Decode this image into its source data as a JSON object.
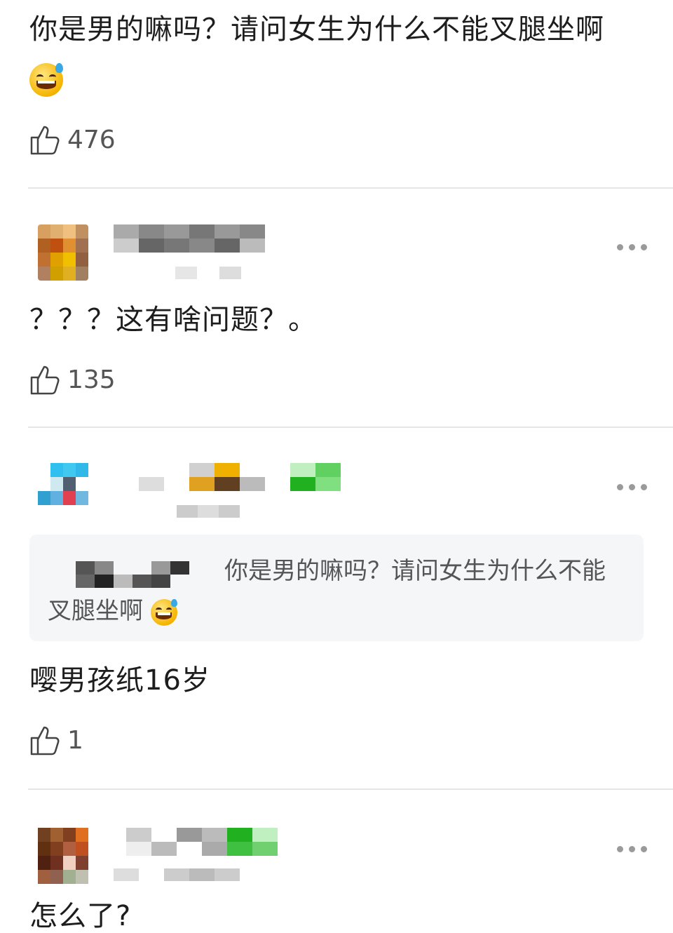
{
  "post": {
    "text": "你是男的嘛吗？请问女生为什么不能叉腿坐啊",
    "emoji": "sweat-smile-emoji",
    "likes": "476"
  },
  "comments": [
    {
      "text": "？？？这有啥问题？。",
      "likes": "135"
    },
    {
      "quote_text_line1": "你是男的嘛吗？请问女生为什么不能",
      "quote_text_line2": "叉腿坐啊",
      "text": "嘤男孩纸16岁",
      "likes": "1"
    },
    {
      "text": "怎么了?"
    }
  ],
  "colors": {
    "divider": "#e6e6e6",
    "text": "#1d1d1d",
    "muted": "#555555",
    "quote_bg": "#f5f6f8"
  },
  "icons": {
    "like": "thumbs-up-icon",
    "more": "more-dots-icon"
  }
}
